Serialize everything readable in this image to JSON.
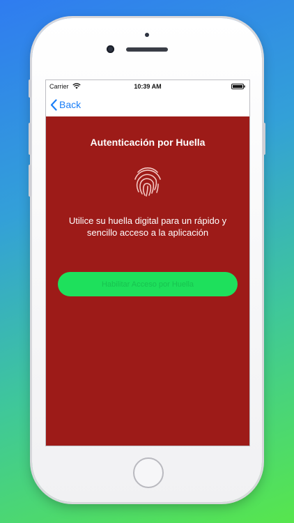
{
  "status_bar": {
    "carrier": "Carrier",
    "time": "10:39 AM"
  },
  "nav": {
    "back_label": "Back"
  },
  "screen": {
    "title": "Autenticación por Huella",
    "description": "Utilice su huella digital para un rápido y sencillo acceso a la aplicación",
    "button_label": "Habilitar Acceso por Huella"
  },
  "icons": [
    "wifi-icon",
    "battery-icon",
    "chevron-left-icon",
    "fingerprint-icon"
  ],
  "colors": {
    "content_background": "#9d1b18",
    "button_background": "#1ee05c",
    "accent_blue": "#1a7ef7"
  }
}
